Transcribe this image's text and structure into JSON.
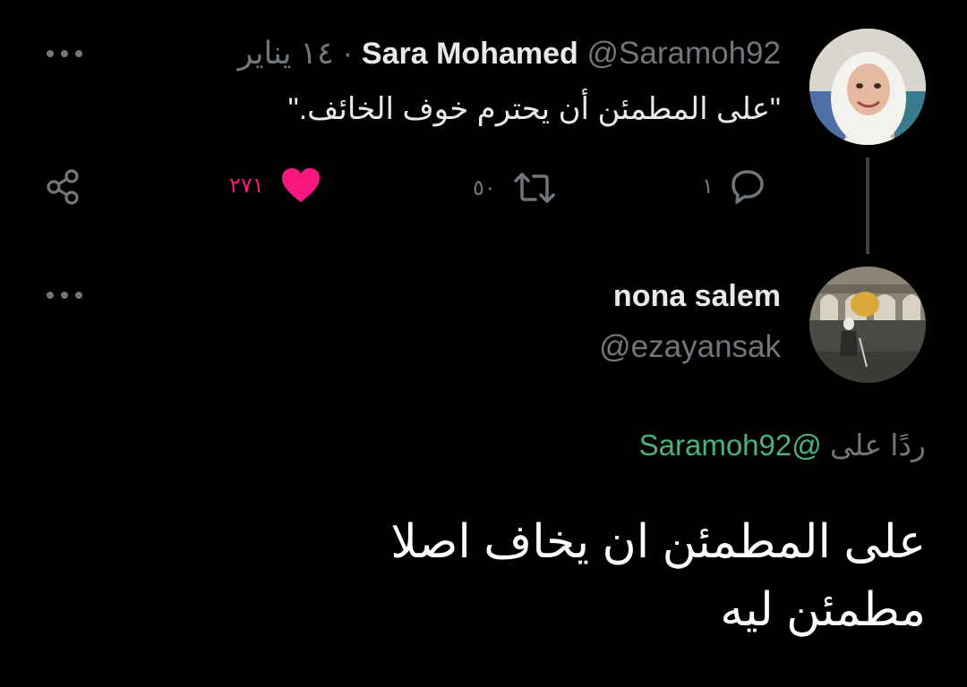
{
  "colors": {
    "background": "#000000",
    "text": "#e7e9ea",
    "muted": "#71767b",
    "like": "#f91880",
    "mention": "#4ab37d",
    "thread_line": "#3e4144"
  },
  "tweet": {
    "author_name": "Sara Mohamed",
    "handle": "@Saramoh92",
    "separator": "·",
    "date": "١٤ يناير",
    "text": "\"على المطمئن أن يحترم خوف الخائف.\"",
    "actions": {
      "reply": {
        "icon": "reply-bubble-icon",
        "count": "١"
      },
      "retweet": {
        "icon": "retweet-icon",
        "count": "٥٠"
      },
      "like": {
        "icon": "heart-icon",
        "count": "٢٧١"
      },
      "share": {
        "icon": "share-icon"
      }
    },
    "more_icon": "more-dots-icon"
  },
  "reply": {
    "author_name": "nona salem",
    "handle": "@ezayansak",
    "replying_label": "ردًا على",
    "replying_to": "@Saramoh92",
    "text_line1": "على المطمئن ان يخاف اصلا",
    "text_line2": "مطمئن ليه",
    "more_icon": "more-dots-icon"
  }
}
